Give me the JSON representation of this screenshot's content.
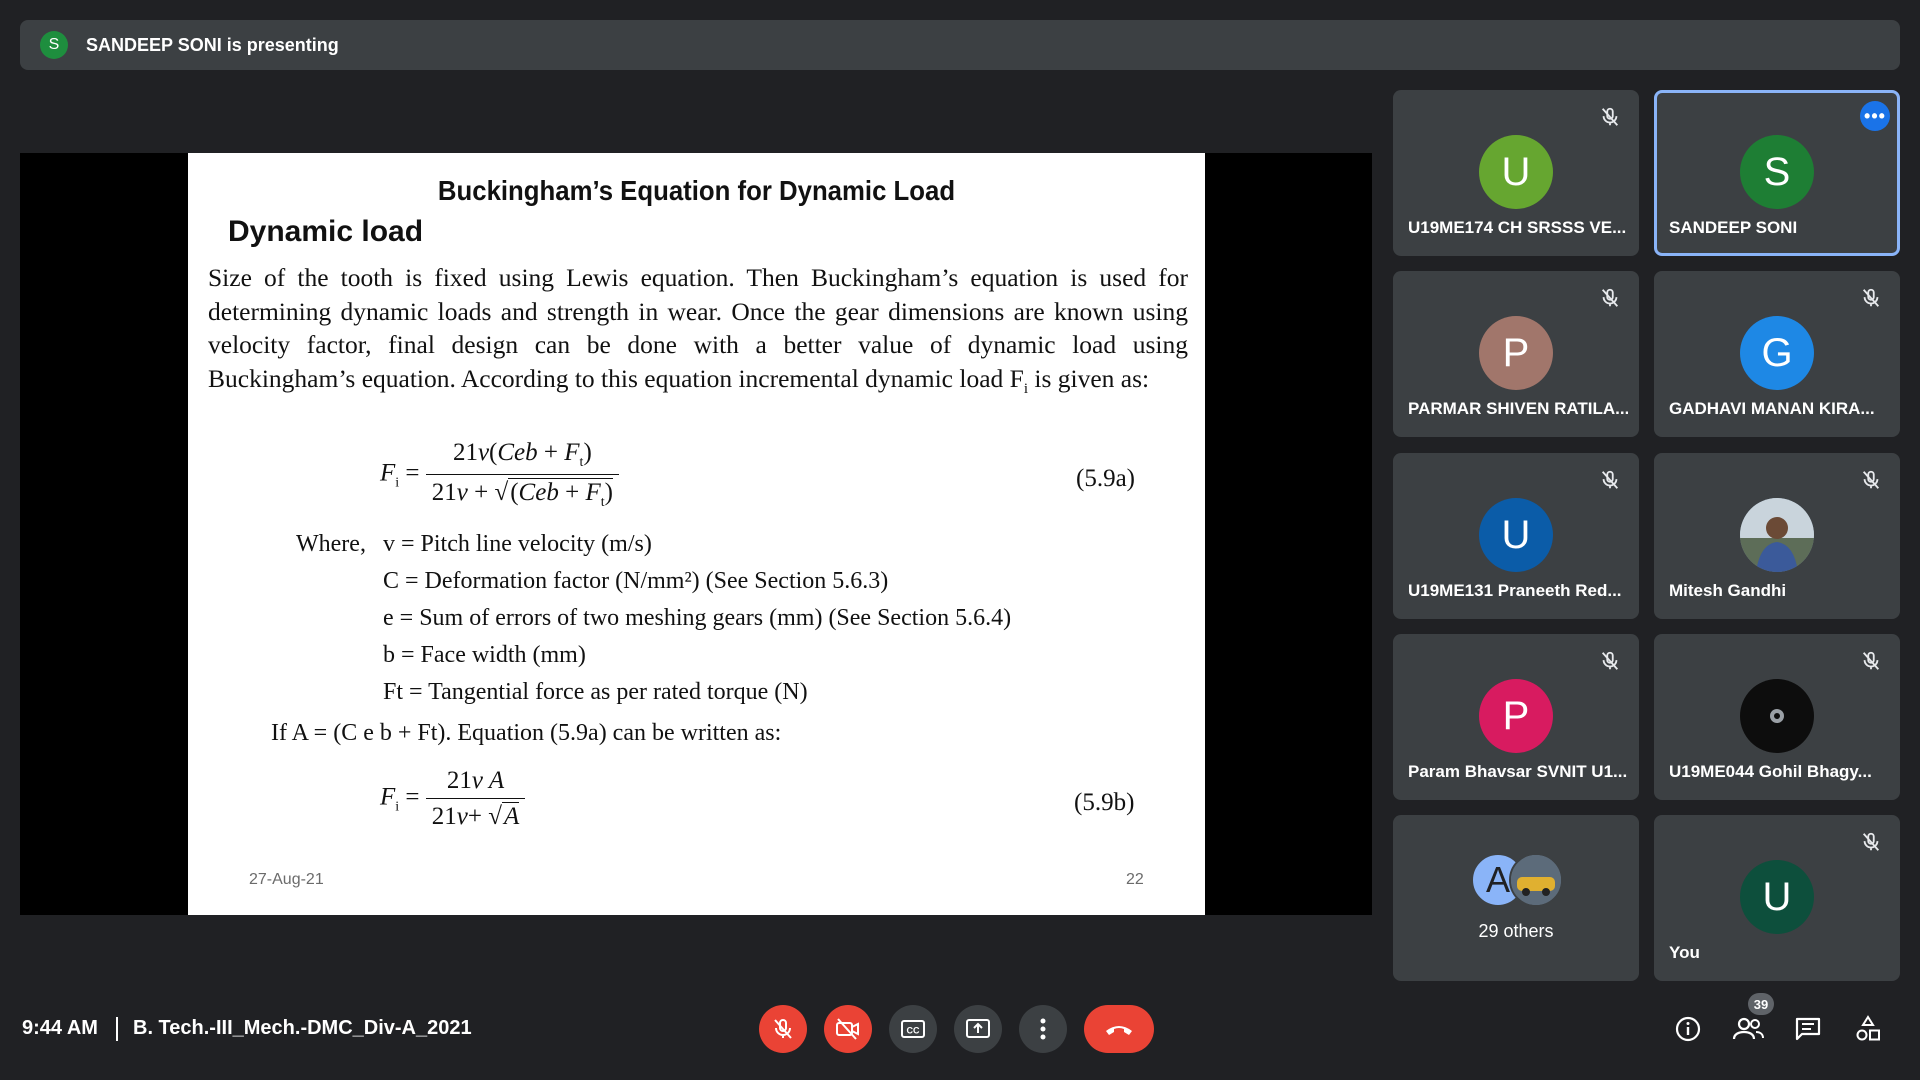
{
  "presenter_bar": {
    "avatar_letter": "S",
    "text": "SANDEEP SONI is presenting"
  },
  "slide": {
    "title": "Buckingham’s Equation for Dynamic Load",
    "subtitle": "Dynamic load",
    "paragraph": "Size of the tooth is fixed using Lewis equation. Then Buckingham’s equation is used for determining dynamic loads and strength in wear. Once the gear dimensions are known using velocity factor, final design can be done with a better value of dynamic load using Buckingham’s equation. According to this equation incremental dynamic load F",
    "paragraph_sub": "i",
    "paragraph_end": " is given as:",
    "eq1_number": "(5.9a)",
    "where_label": "Where,",
    "definitions": [
      "v = Pitch line velocity (m/s)",
      "C = Deformation factor (N/mm²) (See Section 5.6.3)",
      "e = Sum of errors of two meshing gears (mm) (See Section 5.6.4)",
      "b = Face width (mm)",
      "Ft = Tangential force as per rated torque (N)"
    ],
    "if_line": "If A = (C e b + Ft). Equation (5.9a) can be written as:",
    "eq2_number": "(5.9b)",
    "date": "27-Aug-21",
    "page_number": "22"
  },
  "participants": [
    {
      "name": "U19ME174 CH SRSSS VE...",
      "letter": "U",
      "color": "#66a630",
      "mic_off": true
    },
    {
      "name": "SANDEEP SONI",
      "letter": "S",
      "color": "#1e7e34",
      "mic_off": false,
      "active": true
    },
    {
      "name": "PARMAR SHIVEN RATILA...",
      "letter": "P",
      "color": "#a1766b",
      "mic_off": true
    },
    {
      "name": "GADHAVI MANAN KIRA...",
      "letter": "G",
      "color": "#1e88e5",
      "mic_off": true
    },
    {
      "name": "U19ME131 Praneeth Red...",
      "letter": "U",
      "color": "#0b5ca8",
      "mic_off": true
    },
    {
      "name": "Mitesh Gandhi",
      "letter": "",
      "color": "#7a8fa3",
      "mic_off": true,
      "photo": true
    },
    {
      "name": "Param Bhavsar SVNIT U1...",
      "letter": "P",
      "color": "#d81b60",
      "mic_off": true
    },
    {
      "name": "U19ME044 Gohil Bhagy...",
      "letter": "",
      "color": "#0d0d0d",
      "mic_off": true,
      "photo": true
    },
    {
      "name": "You",
      "letter": "U",
      "color": "#0d4f3c",
      "mic_off": true
    }
  ],
  "others_tile": {
    "avatar_letter": "A",
    "label": "29 others"
  },
  "bottom_bar": {
    "time": "9:44 AM",
    "meeting_name": "B. Tech.-III_Mech.-DMC_Div-A_2021",
    "participant_count": "39"
  },
  "colors": {
    "background": "#202124",
    "tile": "#3c4043",
    "red": "#ea4335",
    "active_border": "#8ab4f8"
  }
}
